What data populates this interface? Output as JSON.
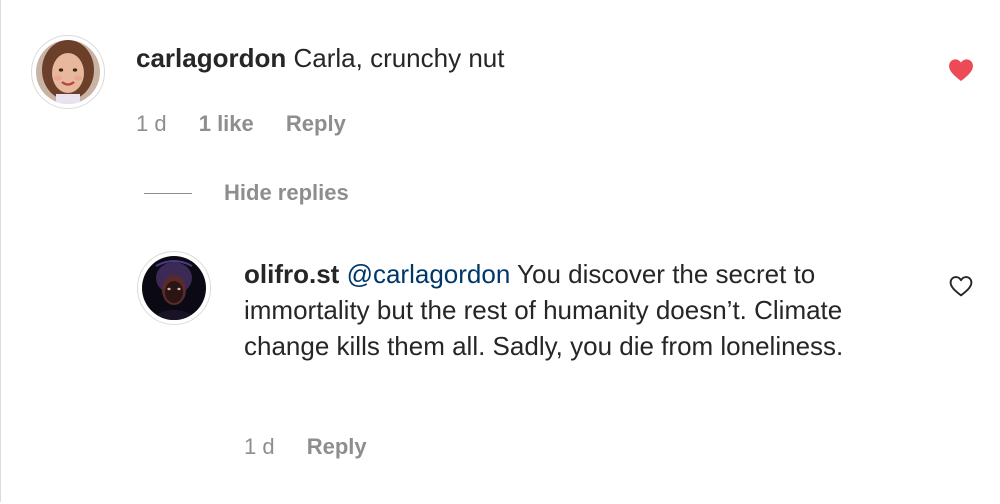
{
  "comment": {
    "username": "carlagordon",
    "text": "Carla, crunchy nut",
    "time": "1 d",
    "likes": "1 like",
    "reply_label": "Reply",
    "liked": true,
    "like_color": "#ed4956"
  },
  "replies_toggle": {
    "label": "Hide replies"
  },
  "reply": {
    "username": "olifro.st",
    "mention": "@carlagordon",
    "text": " You discover the secret to immortality but the rest of humanity doesn’t. Climate change kills them all. Sadly, you die from loneliness.",
    "time": "1 d",
    "reply_label": "Reply",
    "liked": false
  },
  "icons": {
    "comment_like": "heart-filled-icon",
    "reply_like": "heart-outline-icon"
  },
  "colors": {
    "text": "#262626",
    "secondary": "#8e8e8e",
    "mention": "#00376b",
    "border": "#dbdbdb"
  }
}
